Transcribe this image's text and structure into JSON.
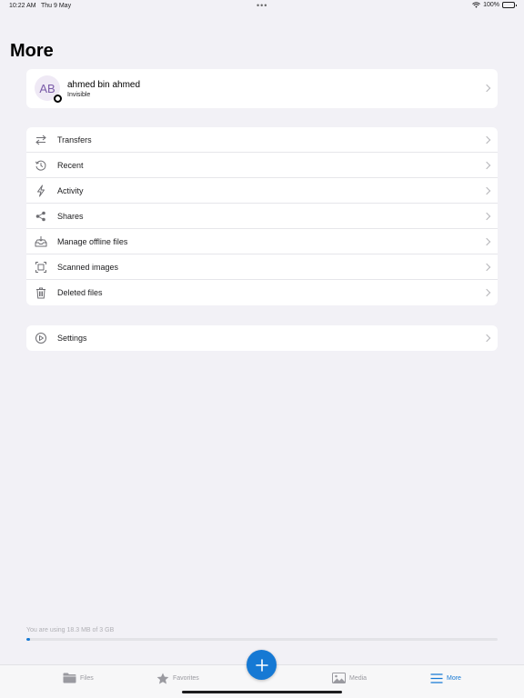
{
  "status_bar": {
    "time": "10:22 AM",
    "date": "Thu 9 May",
    "dots": "•••",
    "battery": "100%"
  },
  "page": {
    "title": "More"
  },
  "profile": {
    "initials": "AB",
    "name": "ahmed bin ahmed",
    "status": "Invisible"
  },
  "menu": {
    "items": [
      {
        "label": "Transfers",
        "icon": "transfers-icon"
      },
      {
        "label": "Recent",
        "icon": "recent-icon"
      },
      {
        "label": "Activity",
        "icon": "activity-icon"
      },
      {
        "label": "Shares",
        "icon": "share-icon"
      },
      {
        "label": "Manage offline files",
        "icon": "offline-files-icon"
      },
      {
        "label": "Scanned images",
        "icon": "scan-icon"
      },
      {
        "label": "Deleted files",
        "icon": "trash-icon"
      }
    ]
  },
  "settings": {
    "label": "Settings",
    "icon": "settings-icon"
  },
  "storage": {
    "text": "You are using 18.3 MB of 3 GB",
    "used_fraction": 0.006
  },
  "tabs": {
    "files": "Files",
    "favorites": "Favorites",
    "media": "Media",
    "more": "More"
  },
  "colors": {
    "accent": "#1679d4",
    "background": "#f2f1f6",
    "avatar_bg": "#efe9f5",
    "avatar_text": "#7a5aa8"
  }
}
